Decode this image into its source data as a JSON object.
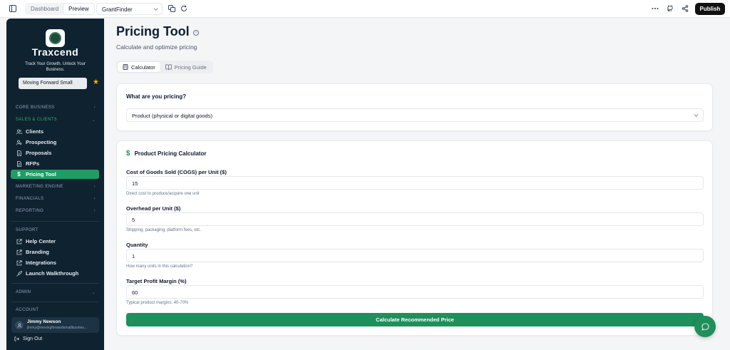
{
  "topbar": {
    "tabs": [
      "Dashboard",
      "Preview"
    ],
    "active_tab": "Preview",
    "project_select": "GrantFinder",
    "publish_label": "Publish"
  },
  "sidebar": {
    "brand": "Traxcend",
    "tagline": "Track Your Growth. Unlock Your Business.",
    "business_select": "Moving Forward Small",
    "sections": {
      "core_business": "CORE BUSINESS",
      "sales_clients": "SALES & CLIENTS",
      "marketing_engine": "MARKETING ENGINE",
      "financials": "FINANCIALS",
      "reporting": "REPORTING",
      "support": "SUPPORT",
      "admin": "ADMIN",
      "account": "ACCOUNT"
    },
    "sales_items": [
      {
        "label": "Clients",
        "icon": "users-icon"
      },
      {
        "label": "Prospecting",
        "icon": "user-search-icon"
      },
      {
        "label": "Proposals",
        "icon": "document-icon"
      },
      {
        "label": "RFPs",
        "icon": "file-text-icon"
      },
      {
        "label": "Pricing Tool",
        "icon": "dollar-icon",
        "active": true
      }
    ],
    "support_items": [
      {
        "label": "Help Center",
        "icon": "external-link-icon"
      },
      {
        "label": "Branding",
        "icon": "external-link-icon"
      },
      {
        "label": "Integrations",
        "icon": "external-link-icon"
      },
      {
        "label": "Launch Walkthrough",
        "icon": "rocket-icon"
      }
    ],
    "user": {
      "name": "Jimmy Newson",
      "email": "jimmy@movingforwardsmallbusines..."
    },
    "sign_out": "Sign Out"
  },
  "main": {
    "title": "Pricing Tool",
    "subtitle": "Calculate and optimize pricing",
    "tabs": [
      {
        "label": "Calculator",
        "active": true
      },
      {
        "label": "Pricing Guide",
        "active": false
      }
    ],
    "what_pricing": {
      "label": "What are you pricing?",
      "selected": "Product (physical or digital goods)"
    },
    "calculator": {
      "title": "Product Pricing Calculator",
      "fields": [
        {
          "label": "Cost of Goods Sold (COGS) per Unit ($)",
          "value": "15",
          "hint": "Direct cost to produce/acquire one unit"
        },
        {
          "label": "Overhead per Unit ($)",
          "value": "5",
          "hint": "Shipping, packaging, platform fees, etc."
        },
        {
          "label": "Quantity",
          "value": "1",
          "hint": "How many units in this calculation?"
        },
        {
          "label": "Target Profit Margin (%)",
          "value": "60",
          "hint": "Typical product margins: 40-70%"
        }
      ],
      "button_label": "Calculate Recommended Price"
    }
  },
  "colors": {
    "accent": "#1f8f5c",
    "sidebar_bg": "#0f2230",
    "active_nav": "#1f9d63"
  }
}
